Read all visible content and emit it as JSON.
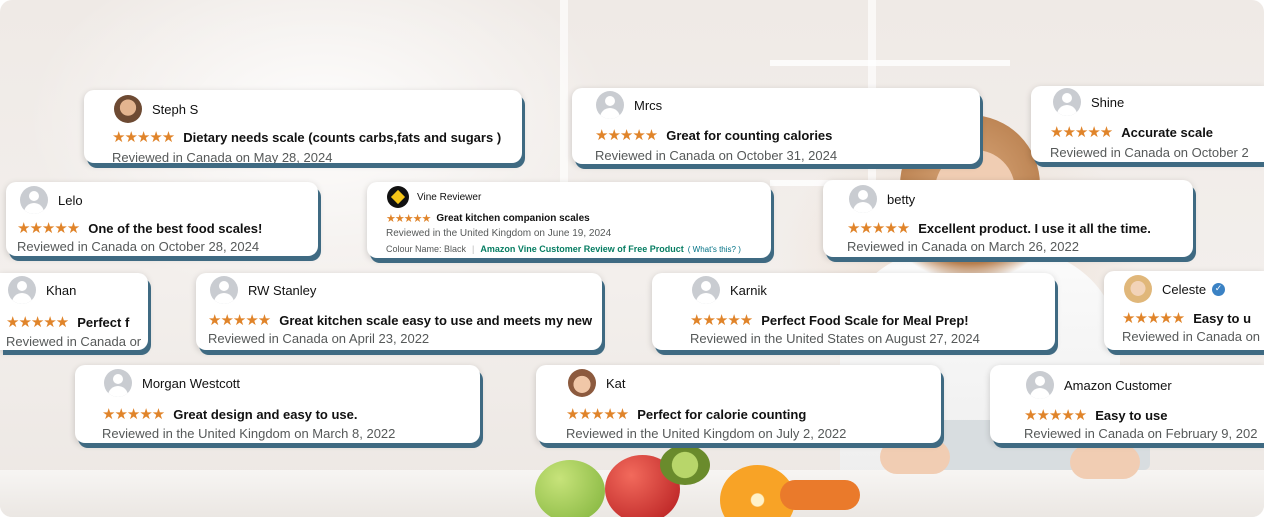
{
  "reviews": [
    {
      "name": "Steph S",
      "title": "Dietary needs scale (counts carbs,fats and sugars )",
      "meta": "Reviewed in Canada on May 28, 2024"
    },
    {
      "name": "Mrcs",
      "title": "Great for counting calories",
      "meta": "Reviewed in Canada on October 31, 2024"
    },
    {
      "name": "Shine",
      "title": "Accurate scale",
      "meta": "Reviewed in Canada on October 2"
    },
    {
      "name": "Lelo",
      "title": "One of the best food scales!",
      "meta": "Reviewed in Canada on October 28, 2024"
    },
    {
      "name": "Vine Reviewer",
      "title": "Great kitchen companion scales",
      "meta": "Reviewed in the United Kingdom on June 19, 2024",
      "colour": "Colour Name: Black",
      "vine_label": "Amazon Vine Customer Review of Free Product",
      "vine_help": "( What's this? )"
    },
    {
      "name": "betty",
      "title": "Excellent product. I use it all the time.",
      "meta": "Reviewed in Canada on March 26, 2022"
    },
    {
      "name": "Khan",
      "title": "Perfect f",
      "meta": "Reviewed in Canada or"
    },
    {
      "name": "RW Stanley",
      "title": "Great kitchen scale easy to use and meets my new",
      "meta": "Reviewed in Canada on April 23, 2022"
    },
    {
      "name": "Karnik",
      "title": "Perfect Food Scale for Meal Prep!",
      "meta": "Reviewed in the United States on August 27, 2024"
    },
    {
      "name": "Celeste",
      "title": "Easy to u",
      "meta": "Reviewed in Canada on"
    },
    {
      "name": "Morgan Westcott",
      "title": "Great design and easy to use.",
      "meta": "Reviewed in the United Kingdom on March 8, 2022"
    },
    {
      "name": "Kat",
      "title": "Perfect for calorie counting",
      "meta": "Reviewed in the United Kingdom on July 2, 2022"
    },
    {
      "name": "Amazon Customer",
      "title": "Easy to use",
      "meta": "Reviewed in Canada on February 9, 202"
    }
  ],
  "stars": "★★★★★",
  "rating": 5,
  "star_color": "#e0842a",
  "icons": {
    "verified": "verified-check-icon",
    "vine": "vine-badge-icon",
    "avatar": "user-avatar-icon"
  }
}
